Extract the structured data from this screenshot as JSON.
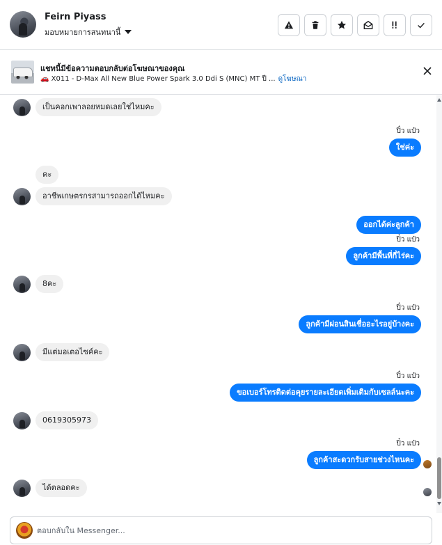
{
  "header": {
    "contact_name": "Feirn Piyass",
    "assign_label": "มอบหมายการสนทนานี้",
    "tools": [
      {
        "name": "report-spam",
        "icon": "warning-icon"
      },
      {
        "name": "delete",
        "icon": "trash-icon"
      },
      {
        "name": "star",
        "icon": "star-icon"
      },
      {
        "name": "mark-unread",
        "icon": "envelope-open-icon"
      },
      {
        "name": "follow-up",
        "icon": "exclamation-icon"
      },
      {
        "name": "done",
        "icon": "check-icon"
      }
    ]
  },
  "ad_banner": {
    "title": "แชทนี้มีข้อความตอบกลับต่อโฆษณาของคุณ",
    "subtitle": "🚗 X011 - D-Max All New Blue Power Spark 3.0 Ddi S (MNC) MT ปี ...",
    "link": "ดูโฆษณา"
  },
  "messages": [
    {
      "dir": "in",
      "text": "เป็นคอกเพาลอยหมดเลยใช่ไหมคะ"
    },
    {
      "dir": "out",
      "sender": "ปิ๋ว แป๋ว",
      "text": "ใช่ค่ะ"
    },
    {
      "dir": "in",
      "text": "คะ"
    },
    {
      "dir": "in",
      "text": "อาชีพเกษตรกรสามารถออกได้ไหมคะ"
    },
    {
      "dir": "out",
      "text": "ออกได้ค่ะลูกค้า"
    },
    {
      "dir": "out",
      "sender": "ปิ๋ว แป๋ว",
      "text": "ลูกค้ามีพื้นที่กี่ไร่คะ"
    },
    {
      "dir": "in",
      "text": "8คะ"
    },
    {
      "dir": "out",
      "sender": "ปิ๋ว แป๋ว",
      "text": "ลูกค้ามีผ่อนสินเชื่ออะไรอยู่บ้างคะ"
    },
    {
      "dir": "in",
      "text": "มีแต่มอเตอไซค์คะ"
    },
    {
      "dir": "out",
      "sender": "ปิ๋ว แป๋ว",
      "text": "ขอเบอร์โทรติดต่อคุยรายละเอียดเพิ่มเติมกับเซลล์นะคะ"
    },
    {
      "dir": "in",
      "text": "0619305973"
    },
    {
      "dir": "out",
      "sender": "ปิ๋ว แป๋ว",
      "text": "ลูกค้าสะดวกรับสายช่วงไหนคะ"
    },
    {
      "dir": "in",
      "text": "ได้ตลอดคะ"
    }
  ],
  "composer": {
    "placeholder": "ตอบกลับใน Messenger..."
  },
  "colors": {
    "outgoing_bubble": "#0a7cff",
    "incoming_bubble": "#f0f0f0",
    "link": "#0a66c2"
  }
}
